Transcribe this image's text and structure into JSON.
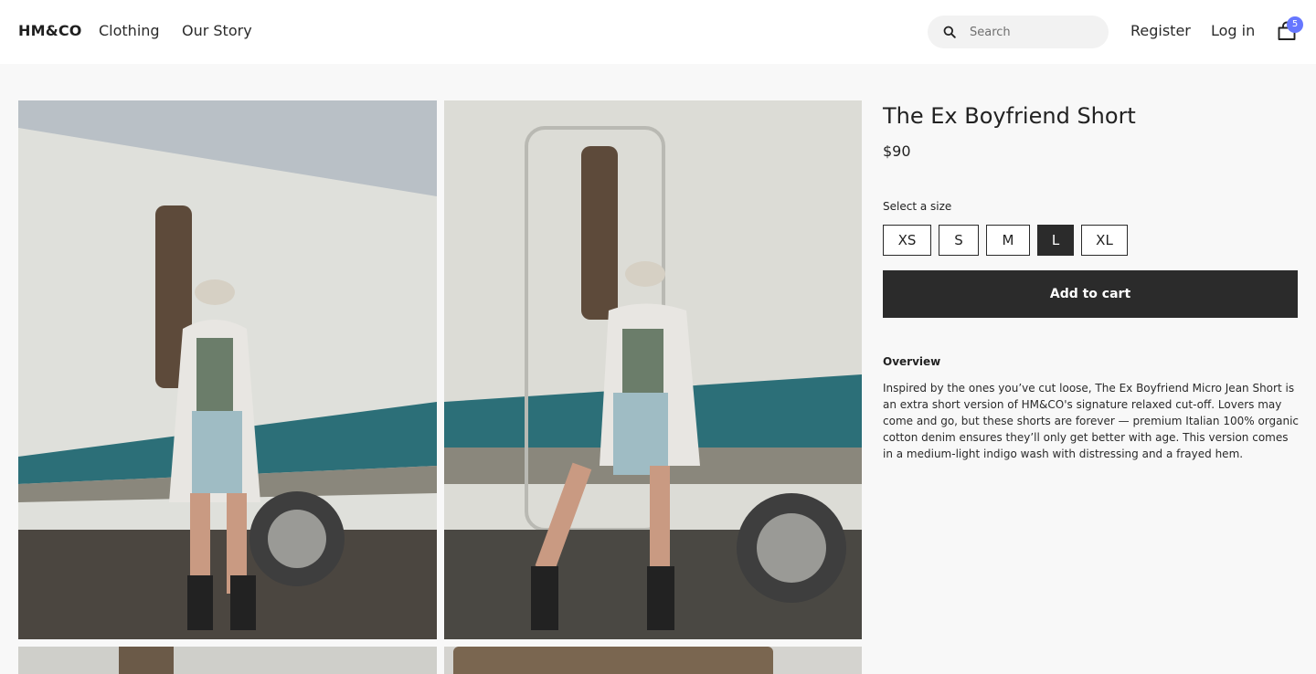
{
  "header": {
    "logo": "HM&CO",
    "nav": [
      "Clothing",
      "Our Story"
    ],
    "search_placeholder": "Search",
    "register": "Register",
    "login": "Log in",
    "cart_count": "5"
  },
  "product": {
    "title": "The Ex Boyfriend Short",
    "price": "$90",
    "size_label": "Select a size",
    "sizes": [
      "XS",
      "S",
      "M",
      "L",
      "XL"
    ],
    "selected_size": "L",
    "add_to_cart": "Add to cart",
    "overview_heading": "Overview",
    "overview_text": "Inspired by the ones you’ve cut loose, The Ex Boyfriend Micro Jean Short is an extra short version of HM&CO's signature relaxed cut-off. Lovers may come and go, but these shorts are forever — premium Italian 100% organic cotton denim ensures they’ll only get better with age. This version comes in a medium-light indigo wash with distressing and a frayed hem."
  },
  "colors": {
    "accent_badge": "#6677ff",
    "button_dark": "#2b2b2b",
    "page_bg": "#f8f8f8"
  }
}
